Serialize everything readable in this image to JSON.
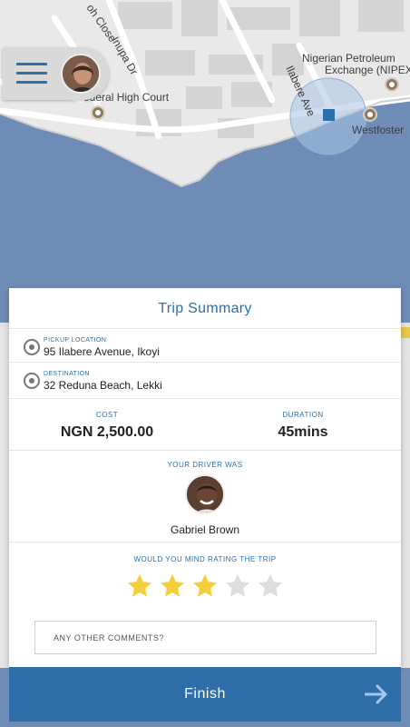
{
  "map": {
    "labels": {
      "close": "oh Close",
      "inupa": "Inupa Dr",
      "court": "ederal High Court",
      "nnpc_line1": "Nigerian Petroleum",
      "nnpc_line2": "Exchange (NIPEX)",
      "ilabere": "Ilabere Ave",
      "westfoster": "Westfoster",
      "dr": "Dr"
    },
    "colors": {
      "water": "#6f8cb6",
      "land": "#ececec",
      "road": "#ffffff",
      "building": "#d6d6d6"
    }
  },
  "header": {
    "menu_icon": "hamburger-menu-icon",
    "avatar_icon": "user-avatar"
  },
  "trip": {
    "title": "Trip Summary",
    "pickup_label": "PICKUP LOCATION",
    "pickup_value": "95 Ilabere Avenue, Ikoyi",
    "destination_label": "DESTINATION",
    "destination_value": "32 Reduna Beach, Lekki",
    "cost_label": "COST",
    "cost_value": "NGN 2,500.00",
    "duration_label": "DURATION",
    "duration_value": "45mins",
    "driver_label": "YOUR DRIVER WAS",
    "driver_name": "Gabriel Brown",
    "rating_label": "WOULD YOU MIND RATING THE TRIP",
    "rating": 3,
    "rating_max": 5,
    "comment_placeholder": "ANY OTHER COMMENTS?",
    "comment_value": ""
  },
  "finish": {
    "label": "Finish",
    "icon": "arrow-right-icon"
  },
  "colors": {
    "accent": "#2b6fab",
    "star_on": "#f5cf3b",
    "star_off": "#dddddd"
  }
}
